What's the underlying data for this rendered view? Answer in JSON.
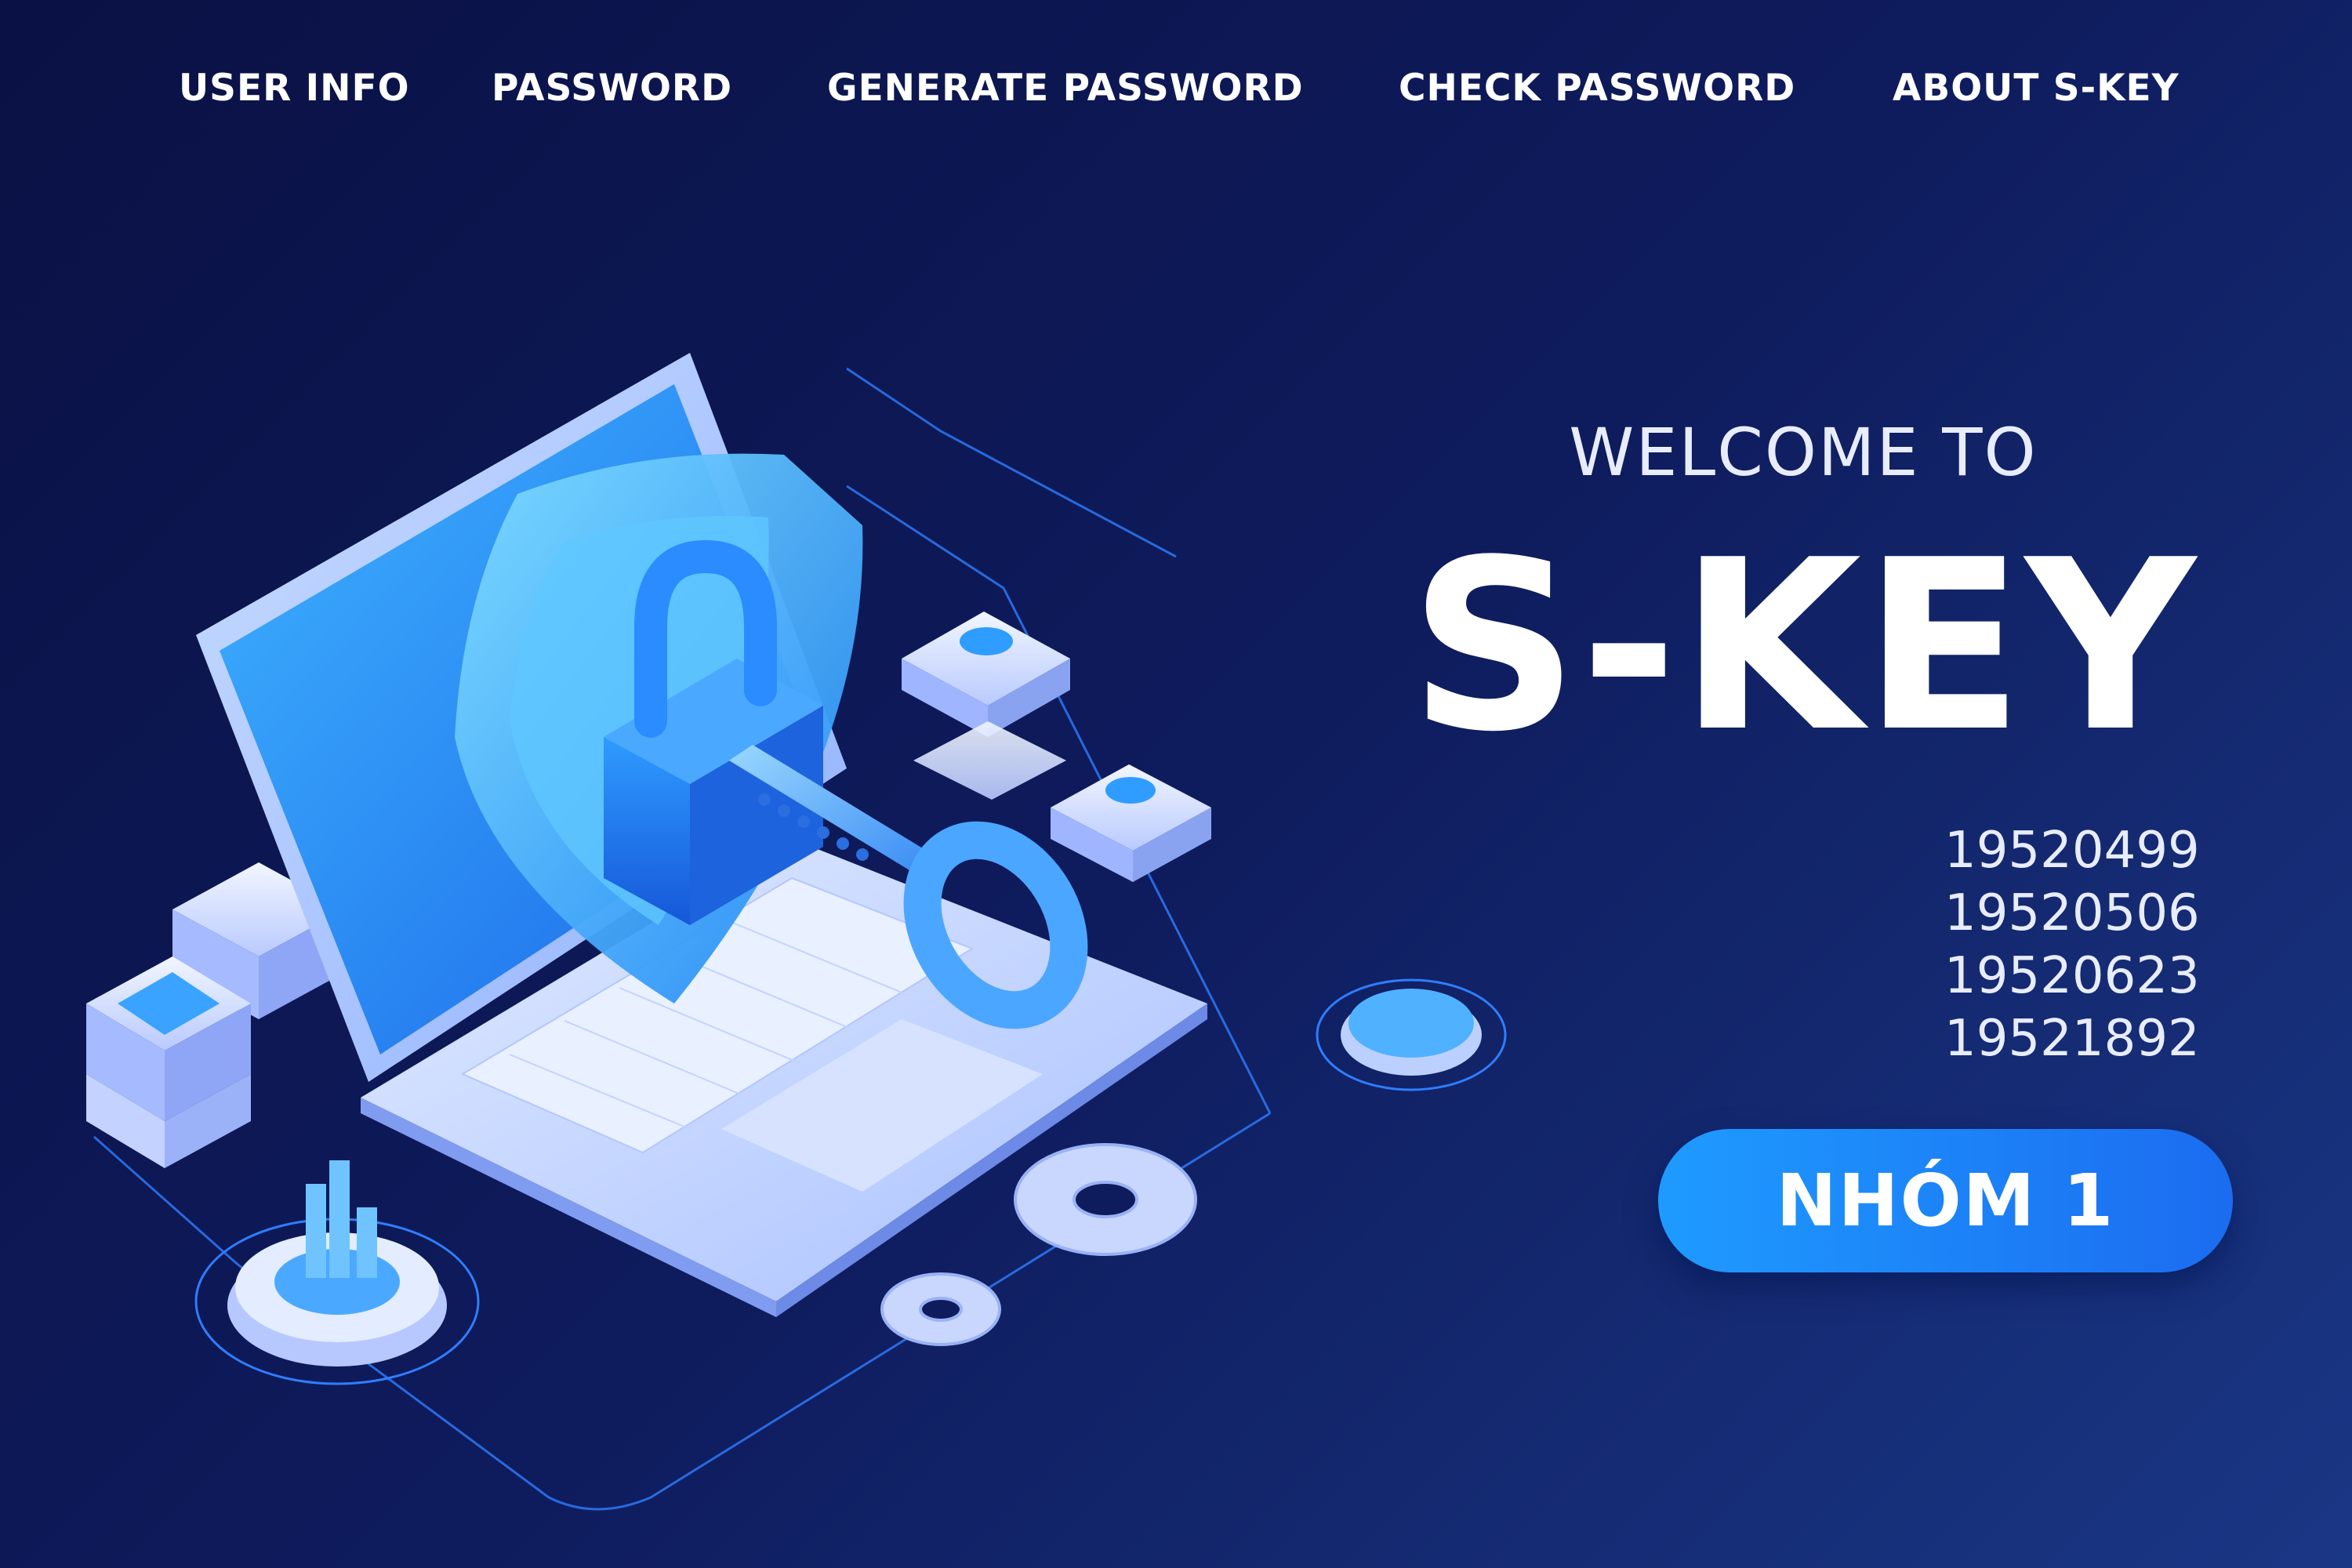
{
  "nav": {
    "items": [
      {
        "label": "USER INFO"
      },
      {
        "label": "PASSWORD"
      },
      {
        "label": "GENERATE PASSWORD"
      },
      {
        "label": "CHECK PASSWORD"
      },
      {
        "label": "ABOUT S-KEY"
      }
    ]
  },
  "hero": {
    "welcome": "WELCOME TO",
    "brand": "S-KEY",
    "ids": [
      "19520499",
      "19520506",
      "19520623",
      "19521892"
    ],
    "group_button": "NHÓM 1"
  },
  "illustration": {
    "icons": [
      "laptop-icon",
      "shield-lock-icon",
      "key-icon",
      "server-stack-icon",
      "gear-icon",
      "power-button-icon",
      "bar-chart-icon"
    ]
  },
  "colors": {
    "background_dark": "#0a1144",
    "background_light": "#1a3785",
    "accent_blue": "#1e9bff",
    "button_blue": "#1b6cf0",
    "text": "#ffffff"
  }
}
